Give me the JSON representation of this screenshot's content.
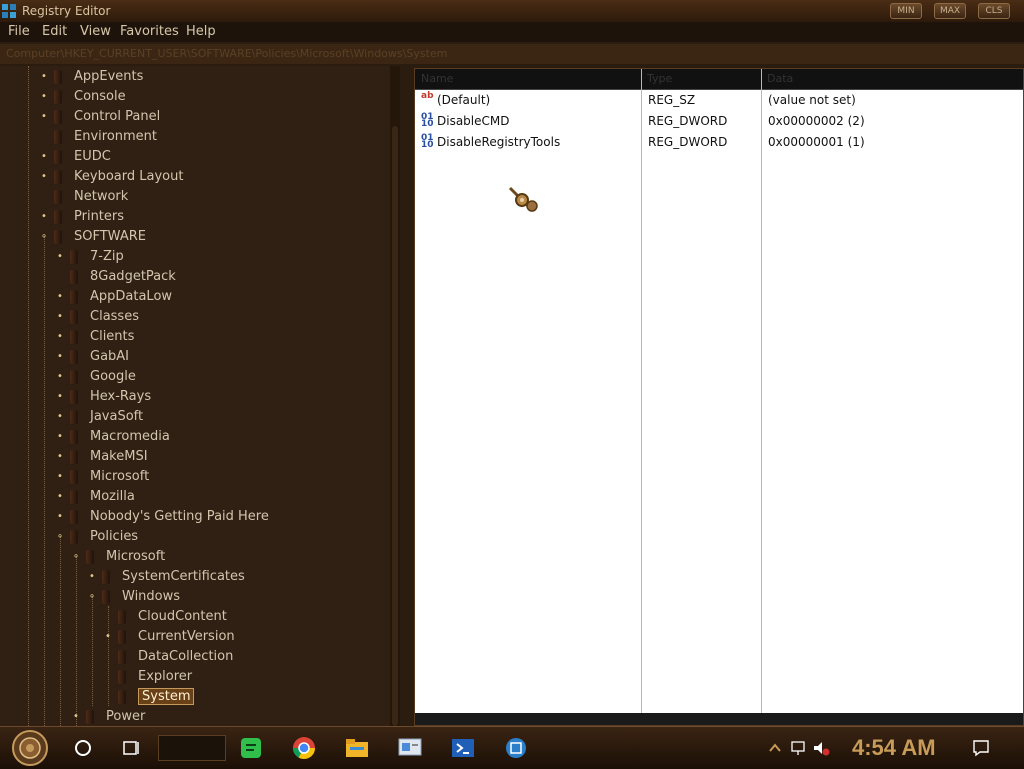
{
  "window": {
    "title": "Registry Editor",
    "minimize_label": "MIN",
    "maximize_label": "MAX",
    "close_label": "CLS"
  },
  "menu": [
    "File",
    "Edit",
    "View",
    "Favorites",
    "Help"
  ],
  "address": "Computer\\HKEY_CURRENT_USER\\SOFTWARE\\Policies\\Microsoft\\Windows\\System",
  "tree": [
    {
      "label": "AppEvents",
      "expandable": true
    },
    {
      "label": "Console",
      "expandable": true
    },
    {
      "label": "Control Panel",
      "expandable": true
    },
    {
      "label": "Environment",
      "expandable": false
    },
    {
      "label": "EUDC",
      "expandable": true
    },
    {
      "label": "Keyboard Layout",
      "expandable": true
    },
    {
      "label": "Network",
      "expandable": false
    },
    {
      "label": "Printers",
      "expandable": true
    },
    {
      "label": "SOFTWARE",
      "expandable": true,
      "expanded": true
    },
    {
      "label": "7-Zip",
      "expandable": true
    },
    {
      "label": "8GadgetPack",
      "expandable": false
    },
    {
      "label": "AppDataLow",
      "expandable": true
    },
    {
      "label": "Classes",
      "expandable": true
    },
    {
      "label": "Clients",
      "expandable": true
    },
    {
      "label": "GabAI",
      "expandable": true
    },
    {
      "label": "Google",
      "expandable": true
    },
    {
      "label": "Hex-Rays",
      "expandable": true
    },
    {
      "label": "JavaSoft",
      "expandable": true
    },
    {
      "label": "Macromedia",
      "expandable": true
    },
    {
      "label": "MakeMSI",
      "expandable": true
    },
    {
      "label": "Microsoft",
      "expandable": true
    },
    {
      "label": "Mozilla",
      "expandable": true
    },
    {
      "label": "Nobody's Getting Paid Here",
      "expandable": true
    },
    {
      "label": "Policies",
      "expandable": true,
      "expanded": true
    },
    {
      "label": "Microsoft",
      "expandable": true,
      "expanded": true
    },
    {
      "label": "SystemCertificates",
      "expandable": true
    },
    {
      "label": "Windows",
      "expandable": true,
      "expanded": true
    },
    {
      "label": "CloudContent",
      "expandable": false
    },
    {
      "label": "CurrentVersion",
      "expandable": true
    },
    {
      "label": "DataCollection",
      "expandable": false
    },
    {
      "label": "Explorer",
      "expandable": false
    },
    {
      "label": "System",
      "expandable": false,
      "selected": true
    },
    {
      "label": "Power",
      "expandable": true
    }
  ],
  "values_list": {
    "columns": [
      "Name",
      "Type",
      "Data"
    ],
    "rows": [
      {
        "name": "(Default)",
        "type": "REG_SZ",
        "data": "(value not set)",
        "icon": "string-value-icon"
      },
      {
        "name": "DisableCMD",
        "type": "REG_DWORD",
        "data": "0x00000002 (2)",
        "icon": "binary-value-icon"
      },
      {
        "name": "DisableRegistryTools",
        "type": "REG_DWORD",
        "data": "0x00000001 (1)",
        "icon": "binary-value-icon"
      }
    ]
  },
  "taskbar": {
    "apps": [
      "sticky-notes-icon",
      "chrome-icon",
      "file-explorer-icon",
      "control-panel-icon",
      "powershell-icon",
      "network-app-icon"
    ],
    "clock": "4:54 AM"
  }
}
